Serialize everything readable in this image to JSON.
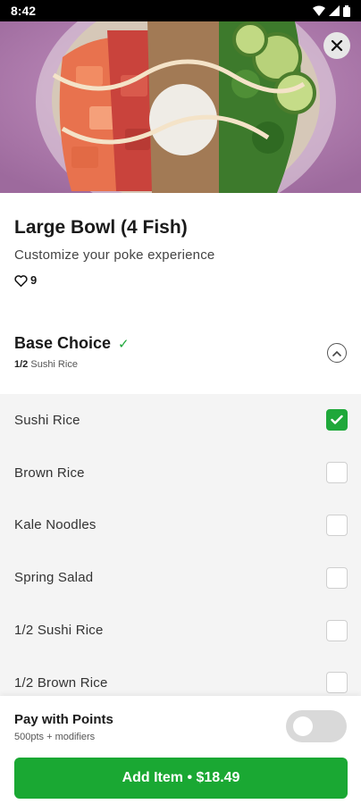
{
  "status_bar": {
    "time": "8:42"
  },
  "item": {
    "title": "Large Bowl (4 Fish)",
    "subtitle": "Customize your poke experience",
    "like_count": "9"
  },
  "section": {
    "title": "Base Choice",
    "selected_count": "1/2",
    "selected_summary": "Sushi Rice"
  },
  "options": [
    {
      "label": "Sushi Rice",
      "checked": true
    },
    {
      "label": "Brown Rice",
      "checked": false
    },
    {
      "label": "Kale Noodles",
      "checked": false
    },
    {
      "label": "Spring Salad",
      "checked": false
    },
    {
      "label": "1/2 Sushi Rice",
      "checked": false
    },
    {
      "label": "1/2 Brown Rice",
      "checked": false
    }
  ],
  "points": {
    "title": "Pay with Points",
    "subtitle": "500pts + modifiers",
    "enabled": false
  },
  "add_button": {
    "label": "Add Item • $18.49"
  },
  "colors": {
    "accent_green": "#1aa833",
    "checkbox_green": "#1fa83a",
    "option_bg": "#f4f4f4"
  }
}
